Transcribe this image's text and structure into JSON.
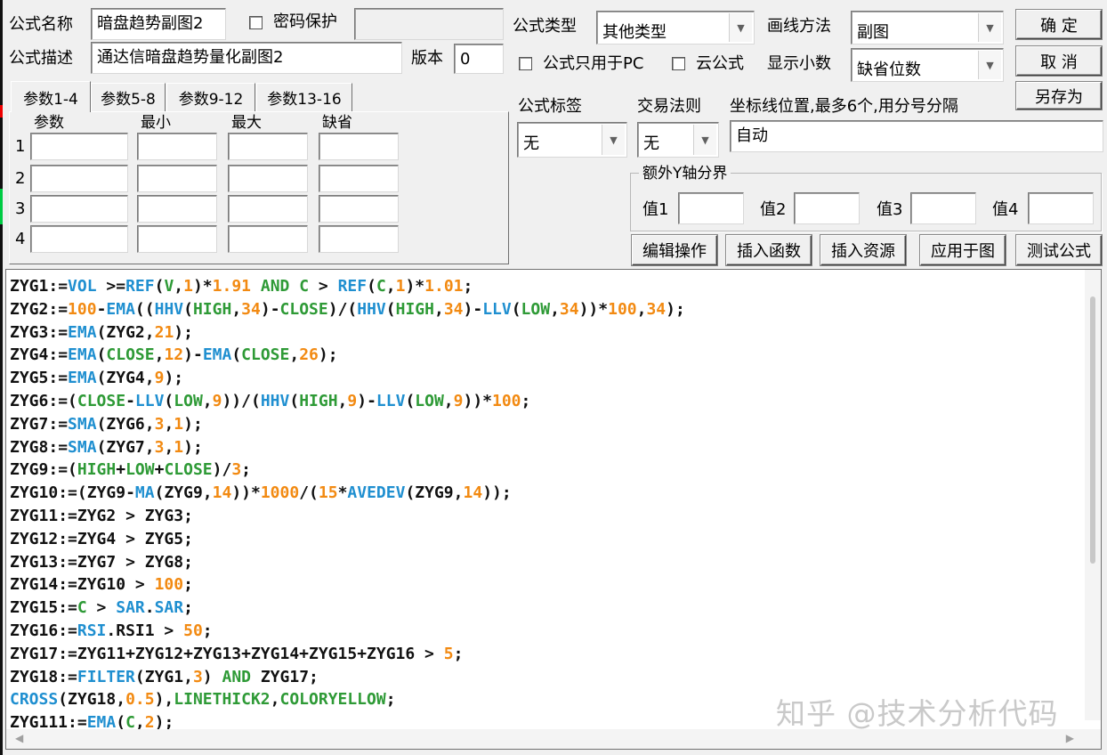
{
  "formula_name": {
    "label": "公式名称",
    "value": "暗盘趋势副图2"
  },
  "password_protect": {
    "label": "密码保护",
    "checked": false
  },
  "formula_desc": {
    "label": "公式描述",
    "value": "通达信暗盘趋势量化副图2"
  },
  "version": {
    "label": "版本",
    "value": "0"
  },
  "formula_type": {
    "label": "公式类型",
    "value": "其他类型"
  },
  "draw_method": {
    "label": "画线方法",
    "value": "副图"
  },
  "pc_only": {
    "label": "公式只用于PC",
    "checked": false
  },
  "cloud_formula": {
    "label": "云公式",
    "checked": false
  },
  "decimals": {
    "label": "显示小数",
    "value": "缺省位数"
  },
  "buttons": {
    "ok": "确 定",
    "cancel": "取 消",
    "save_as": "另存为"
  },
  "tabs": [
    {
      "label": "参数1-4",
      "active": true
    },
    {
      "label": "参数5-8",
      "active": false
    },
    {
      "label": "参数9-12",
      "active": false
    },
    {
      "label": "参数13-16",
      "active": false
    }
  ],
  "param_headers": [
    "参数",
    "最小",
    "最大",
    "缺省"
  ],
  "param_rows": [
    "1",
    "2",
    "3",
    "4"
  ],
  "formula_tag": {
    "label": "公式标签",
    "value": "无"
  },
  "trade_rule": {
    "label": "交易法则",
    "value": "无"
  },
  "axis_position": {
    "label": "坐标线位置,最多6个,用分号分隔",
    "value": "自动"
  },
  "extra_y": {
    "title": "额外Y轴分界",
    "v1": "值1",
    "v2": "值2",
    "v3": "值3",
    "v4": "值4"
  },
  "actions": {
    "edit": "编辑操作",
    "insert_func": "插入函数",
    "insert_res": "插入资源",
    "apply": "应用于图",
    "test": "测试公式"
  },
  "code_lines": [
    "ZYG1:=VOL >=REF(V,1)*1.91 AND C > REF(C,1)*1.01;",
    "ZYG2:=100-EMA((HHV(HIGH,34)-CLOSE)/(HHV(HIGH,34)-LLV(LOW,34))*100,34);",
    "ZYG3:=EMA(ZYG2,21);",
    "ZYG4:=EMA(CLOSE,12)-EMA(CLOSE,26);",
    "ZYG5:=EMA(ZYG4,9);",
    "ZYG6:=(CLOSE-LLV(LOW,9))/(HHV(HIGH,9)-LLV(LOW,9))*100;",
    "ZYG7:=SMA(ZYG6,3,1);",
    "ZYG8:=SMA(ZYG7,3,1);",
    "ZYG9:=(HIGH+LOW+CLOSE)/3;",
    "ZYG10:=(ZYG9-MA(ZYG9,14))*1000/(15*AVEDEV(ZYG9,14));",
    "ZYG11:=ZYG2 > ZYG3;",
    "ZYG12:=ZYG4 > ZYG5;",
    "ZYG13:=ZYG7 > ZYG8;",
    "ZYG14:=ZYG10 > 100;",
    "ZYG15:=C > SAR.SAR;",
    "ZYG16:=RSI.RSI1 > 50;",
    "ZYG17:=ZYG11+ZYG12+ZYG13+ZYG14+ZYG15+ZYG16 > 5;",
    "ZYG18:=FILTER(ZYG1,3) AND ZYG17;",
    "CROSS(ZYG18,0.5),LINETHICK2,COLORYELLOW;",
    "ZYG111:=EMA(C,2);"
  ],
  "syntax": {
    "functions": [
      "VOL",
      "REF",
      "EMA",
      "HHV",
      "LLV",
      "SMA",
      "MA",
      "AVEDEV",
      "SAR",
      "RSI",
      "FILTER",
      "CROSS"
    ],
    "keywords": [
      "AND",
      "HIGH",
      "LOW",
      "CLOSE",
      "LINETHICK2",
      "COLORYELLOW",
      "V",
      "C"
    ],
    "colors": {
      "function": "#1f8fd0",
      "keyword": "#2e9a36",
      "number": "#f28a12"
    }
  },
  "watermark": "知乎 @技术分析代码"
}
